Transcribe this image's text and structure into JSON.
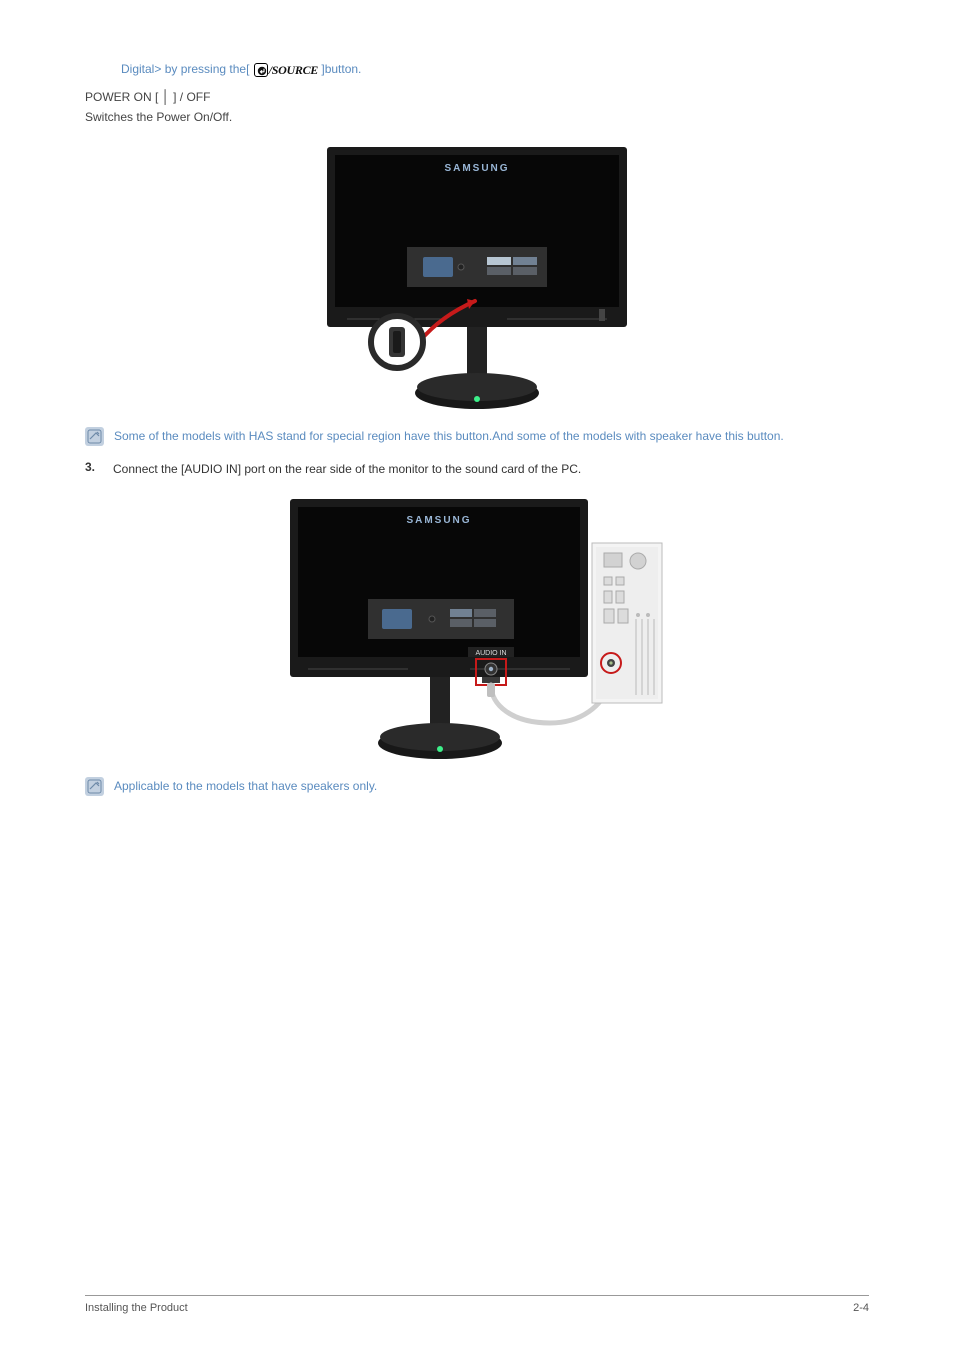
{
  "top": {
    "digital_prefix": "Digital> by pressing the[",
    "digital_suffix": "]button.",
    "source_label": "/SOURCE",
    "power_line": "POWER ON [ ",
    "power_symbol": "│",
    "power_line_end": " ] / OFF",
    "power_desc": "Switches the Power On/Off."
  },
  "fig1": {
    "brand": "SAMSUNG"
  },
  "note1": {
    "text": "Some of the models with HAS stand for special region  have this button.And some of the models with speaker have this button."
  },
  "step3": {
    "num": "3.",
    "text": "Connect the [AUDIO IN] port on the rear side of the monitor to the sound card of the PC."
  },
  "fig2": {
    "brand": "SAMSUNG",
    "port_label": "AUDIO IN"
  },
  "note2": {
    "text": "Applicable to the models that have speakers only."
  },
  "footer": {
    "left": "Installing the Product",
    "right": "2-4"
  }
}
